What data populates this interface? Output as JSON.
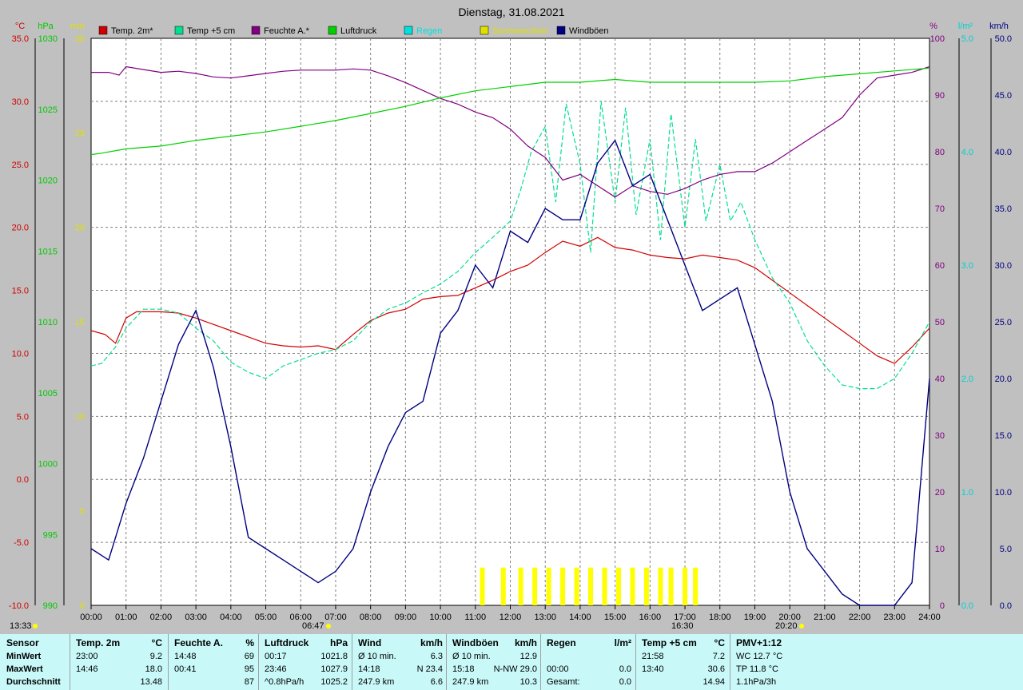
{
  "chart_data": {
    "type": "line",
    "title": "Dienstag, 31.08.2021",
    "x_ticks": [
      "00:00",
      "01:00",
      "02:00",
      "03:00",
      "04:00",
      "05:00",
      "06:00",
      "07:00",
      "08:00",
      "09:00",
      "10:00",
      "11:00",
      "12:00",
      "13:00",
      "14:00",
      "15:00",
      "16:00",
      "17:00",
      "18:00",
      "19:00",
      "20:00",
      "21:00",
      "22:00",
      "23:00",
      "24:00"
    ],
    "axes": [
      {
        "unit": "°C",
        "color": "#d00000",
        "min": -10,
        "max": 35,
        "ticks": [
          "35.0",
          "30.0",
          "25.0",
          "20.0",
          "15.0",
          "10.0",
          "5.0",
          "0.0",
          "-5.0",
          "-10.0"
        ]
      },
      {
        "unit": "hPa",
        "color": "#00c800",
        "min": 990,
        "max": 1030,
        "ticks": [
          "1030",
          "1025",
          "1020",
          "1015",
          "1010",
          "1005",
          "1000",
          "995",
          "990"
        ]
      },
      {
        "unit": "min",
        "color": "#e0e000",
        "min": 0,
        "max": 30,
        "ticks": [
          "30",
          "25",
          "20",
          "15",
          "10",
          "5",
          "0"
        ]
      },
      {
        "unit": "%",
        "color": "#800080",
        "min": 0,
        "max": 100,
        "ticks": [
          "100",
          "90",
          "80",
          "70",
          "60",
          "50",
          "40",
          "30",
          "20",
          "10",
          "0"
        ]
      },
      {
        "unit": "l/m²",
        "color": "#00d0d0",
        "min": 0,
        "max": 5,
        "ticks": [
          "5.0",
          "4.0",
          "3.0",
          "2.0",
          "1.0",
          "0.0"
        ]
      },
      {
        "unit": "km/h",
        "color": "#000080",
        "min": 0,
        "max": 50,
        "ticks": [
          "50.0",
          "45.0",
          "40.0",
          "35.0",
          "30.0",
          "25.0",
          "20.0",
          "15.0",
          "10.0",
          "5.0",
          "0.0"
        ]
      }
    ],
    "legend": [
      {
        "name": "Temp. 2m*",
        "color": "#d00000"
      },
      {
        "name": "Temp +5 cm",
        "color": "#00e090"
      },
      {
        "name": "Feuchte A.*",
        "color": "#800080"
      },
      {
        "name": "Luftdruck",
        "color": "#00d000"
      },
      {
        "name": "Regen",
        "color": "#00e0e0"
      },
      {
        "name": "Sonnenschein",
        "color": "#e0e000"
      },
      {
        "name": "Windböen",
        "color": "#000080"
      }
    ],
    "markers": {
      "left": "13:33",
      "sunrise": "06:47",
      "sunset": "20:20",
      "peak": "16:30"
    },
    "series": [
      {
        "name": "Temp. 2m*",
        "axis": "°C",
        "color": "#d00000",
        "x": [
          0,
          0.4,
          0.7,
          1,
          1.3,
          2,
          2.5,
          3,
          3.5,
          4,
          4.5,
          5,
          5.5,
          6,
          6.5,
          7,
          7.5,
          8,
          8.5,
          9,
          9.5,
          10,
          10.5,
          11,
          11.5,
          12,
          12.5,
          13,
          13.5,
          14,
          14.5,
          15,
          15.5,
          16,
          16.5,
          17,
          17.5,
          18,
          18.5,
          19,
          19.5,
          20,
          20.5,
          21,
          21.5,
          22,
          22.5,
          23,
          23.5,
          24
        ],
        "y": [
          11.8,
          11.5,
          10.8,
          12.8,
          13.3,
          13.3,
          13.2,
          12.8,
          12.3,
          11.8,
          11.3,
          10.8,
          10.6,
          10.5,
          10.6,
          10.3,
          11.5,
          12.6,
          13.2,
          13.5,
          14.3,
          14.5,
          14.6,
          15.2,
          15.8,
          16.5,
          17,
          18,
          18.9,
          18.5,
          19.2,
          18.4,
          18.2,
          17.8,
          17.6,
          17.5,
          17.8,
          17.6,
          17.4,
          16.8,
          15.8,
          14.8,
          13.8,
          12.8,
          11.8,
          10.8,
          9.8,
          9.2,
          10.5,
          12
        ]
      },
      {
        "name": "Temp +5 cm",
        "axis": "°C",
        "color": "#00e090",
        "x": [
          0,
          0.3,
          0.7,
          1,
          1.5,
          2,
          2.5,
          3,
          3.5,
          4,
          4.5,
          5,
          5.5,
          6,
          6.5,
          7,
          7.5,
          8,
          8.5,
          9,
          9.5,
          10,
          10.5,
          11,
          11.5,
          12,
          12.3,
          12.6,
          13,
          13.3,
          13.6,
          14,
          14.3,
          14.6,
          15,
          15.3,
          15.6,
          16,
          16.3,
          16.6,
          17,
          17.3,
          17.6,
          18,
          18.3,
          18.6,
          19,
          19.5,
          20,
          20.5,
          21,
          21.5,
          22,
          22.5,
          23,
          23.5,
          24
        ],
        "y": [
          9,
          9.2,
          10.5,
          12,
          13.5,
          13.5,
          13.2,
          12,
          11,
          9.3,
          8.5,
          8,
          9,
          9.5,
          10,
          10.3,
          11,
          12.5,
          13.5,
          14,
          14.8,
          15.5,
          16.5,
          18,
          19.2,
          20.5,
          23,
          26,
          28,
          22,
          29.8,
          25,
          18,
          30,
          22,
          29.5,
          21,
          27,
          19,
          29,
          20,
          27,
          20.5,
          25,
          20.5,
          22,
          19,
          16,
          14,
          11,
          9,
          7.5,
          7.2,
          7.2,
          8,
          10,
          12.5
        ]
      },
      {
        "name": "Feuchte A.*",
        "axis": "%",
        "color": "#800080",
        "x": [
          0,
          0.5,
          0.8,
          1,
          1.5,
          2,
          2.5,
          3,
          3.5,
          4,
          4.5,
          5,
          5.5,
          6,
          6.5,
          7,
          7.5,
          8,
          8.5,
          9,
          9.5,
          10,
          10.5,
          11,
          11.5,
          12,
          12.5,
          13,
          13.5,
          14,
          14.5,
          15,
          15.5,
          16,
          16.5,
          17,
          17.5,
          18,
          18.5,
          19,
          19.5,
          20,
          20.5,
          21,
          21.5,
          22,
          22.5,
          23,
          23.5,
          24
        ],
        "y": [
          94,
          94,
          93.5,
          95,
          94.5,
          94,
          94.2,
          93.8,
          93.2,
          93,
          93.4,
          93.8,
          94.2,
          94.4,
          94.4,
          94.4,
          94.6,
          94.4,
          93.4,
          92.2,
          90.8,
          89.4,
          88.4,
          87,
          86,
          84,
          81,
          79,
          75,
          76,
          74,
          72,
          74,
          73,
          72.5,
          73.5,
          75,
          76,
          76.5,
          76.5,
          78,
          80,
          82,
          84,
          86,
          90,
          93,
          93.5,
          94,
          95
        ]
      },
      {
        "name": "Luftdruck",
        "axis": "hPa",
        "color": "#00d000",
        "x": [
          0,
          0.3,
          1,
          2,
          3,
          4,
          5,
          6,
          7,
          8,
          9,
          10,
          11,
          12,
          13,
          14,
          15,
          16,
          17,
          18,
          19,
          20,
          21,
          22,
          23,
          24
        ],
        "y": [
          1021.8,
          1021.9,
          1022.2,
          1022.4,
          1022.8,
          1023.1,
          1023.4,
          1023.8,
          1024.2,
          1024.7,
          1025.2,
          1025.8,
          1026.3,
          1026.6,
          1026.9,
          1026.9,
          1027.1,
          1026.9,
          1026.9,
          1026.9,
          1026.9,
          1027.0,
          1027.3,
          1027.5,
          1027.7,
          1027.9
        ]
      },
      {
        "name": "Windböen",
        "axis": "km/h",
        "color": "#000080",
        "x": [
          0,
          0.5,
          1,
          1.5,
          2,
          2.5,
          3,
          3.5,
          4,
          4.5,
          5,
          5.5,
          6,
          6.5,
          7,
          7.5,
          8,
          8.5,
          9,
          9.5,
          10,
          10.5,
          11,
          11.5,
          12,
          12.5,
          13,
          13.5,
          14,
          14.5,
          15,
          15.5,
          16,
          16.5,
          17,
          17.5,
          18,
          18.5,
          19,
          19.5,
          20,
          20.5,
          21,
          21.5,
          22,
          22.5,
          23,
          23.5,
          24
        ],
        "y": [
          5,
          4,
          9,
          13,
          18,
          23,
          26,
          21,
          14,
          6,
          5,
          4,
          3,
          2,
          3,
          5,
          10,
          14,
          17,
          18,
          24,
          26,
          30,
          28,
          33,
          32,
          35,
          34,
          34,
          39,
          41,
          37,
          38,
          34,
          30,
          26,
          27,
          28,
          23,
          18,
          10,
          5,
          3,
          1,
          0,
          0,
          0,
          2,
          20
        ]
      }
    ],
    "sunshine_minutes": {
      "axis": "min",
      "x": [
        11.2,
        11.8,
        12.3,
        12.7,
        13.1,
        13.5,
        13.9,
        14.3,
        14.7,
        15.1,
        15.5,
        15.9,
        16.3,
        16.6,
        17.0,
        17.3
      ],
      "y": [
        2,
        2,
        2,
        2,
        2,
        2,
        2,
        2,
        2,
        2,
        2,
        2,
        2,
        2,
        2,
        2
      ]
    }
  },
  "stats": {
    "columns": [
      {
        "head": [
          "Sensor"
        ],
        "rows": [
          [
            "MinWert"
          ],
          [
            "MaxWert"
          ],
          [
            "Durchschnitt"
          ]
        ]
      },
      {
        "head": [
          "Temp. 2m",
          "°C"
        ],
        "rows": [
          [
            "23:00",
            "9.2"
          ],
          [
            "14:46",
            "18.0"
          ],
          [
            "",
            "13.48"
          ]
        ]
      },
      {
        "head": [
          "Feuchte A.",
          "%"
        ],
        "rows": [
          [
            "14:48",
            "69"
          ],
          [
            "00:41",
            "95"
          ],
          [
            "",
            "87"
          ]
        ]
      },
      {
        "head": [
          "Luftdruck",
          "hPa"
        ],
        "rows": [
          [
            "00:17",
            "1021.8"
          ],
          [
            "23:46",
            "1027.9"
          ],
          [
            "^0.8hPa/h",
            "1025.2"
          ]
        ]
      },
      {
        "head": [
          "Wind",
          "km/h"
        ],
        "rows": [
          [
            "Ø 10 min.",
            "6.3"
          ],
          [
            "14:18",
            "N 23.4"
          ],
          [
            "247.9 km",
            "6.6"
          ]
        ]
      },
      {
        "head": [
          "Windböen",
          "km/h"
        ],
        "rows": [
          [
            "Ø 10 min.",
            "12.9"
          ],
          [
            "15:18",
            "N-NW 29.0"
          ],
          [
            "247.9 km",
            "10.3"
          ]
        ]
      },
      {
        "head": [
          "Regen",
          "l/m²"
        ],
        "rows": [
          [
            "",
            ""
          ],
          [
            "00:00",
            "0.0"
          ],
          [
            "Gesamt:",
            "0.0"
          ]
        ]
      },
      {
        "head": [
          "Temp +5 cm",
          "°C"
        ],
        "rows": [
          [
            "21:58",
            "7.2"
          ],
          [
            "13:40",
            "30.6"
          ],
          [
            "",
            "14.94"
          ]
        ]
      },
      {
        "head": [
          "PMV+1:12"
        ],
        "rows": [
          [
            "WC 12.7 °C"
          ],
          [
            "TP 11.8 °C"
          ],
          [
            "1.1hPa/3h"
          ]
        ]
      }
    ],
    "first_row_extra": [
      "0.0"
    ]
  }
}
